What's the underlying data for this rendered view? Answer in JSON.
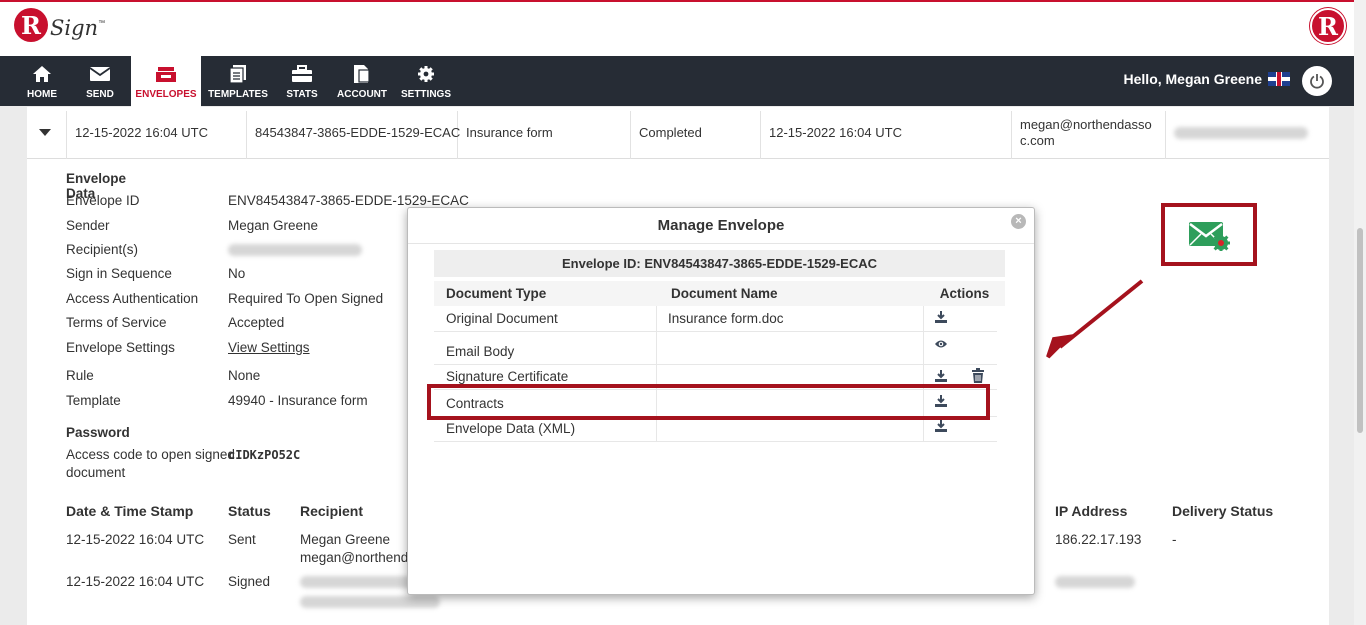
{
  "app": {
    "logo_letter": "R",
    "logo_text": "Sign",
    "logo_tm": "™"
  },
  "nav": {
    "items": [
      {
        "label": "HOME",
        "icon": "home-icon"
      },
      {
        "label": "SEND",
        "icon": "mail-icon"
      },
      {
        "label": "ENVELOPES",
        "icon": "inbox-icon",
        "active": true
      },
      {
        "label": "TEMPLATES",
        "icon": "template-icon"
      },
      {
        "label": "STATS",
        "icon": "briefcase-icon"
      },
      {
        "label": "ACCOUNT",
        "icon": "account-icon"
      },
      {
        "label": "SETTINGS",
        "icon": "gear-icon"
      }
    ],
    "greeting": "Hello, Megan Greene"
  },
  "envelope_row": {
    "sent_date": "12-15-2022 16:04 UTC",
    "envelope_id": "84543847-3865-EDDE-1529-ECAC",
    "subject": "Insurance form",
    "status": "Completed",
    "completed_date": "12-15-2022 16:04 UTC",
    "sender_email": "megan@northendassoc.com"
  },
  "envelope_data": {
    "heading": "Envelope Data",
    "fields": [
      {
        "label": "Envelope ID",
        "value": "ENV84543847-3865-EDDE-1529-ECAC"
      },
      {
        "label": "Sender",
        "value": "Megan Greene"
      },
      {
        "label": "Recipient(s)",
        "value": ""
      },
      {
        "label": "Sign in Sequence",
        "value": "No"
      },
      {
        "label": "Access Authentication",
        "value": "Required To Open Signed"
      },
      {
        "label": "Terms of Service",
        "value": "Accepted"
      },
      {
        "label": "Envelope Settings",
        "value": "View Settings"
      },
      {
        "label": "Rule",
        "value": "None"
      },
      {
        "label": "Template",
        "value": "49940 - Insurance form"
      }
    ],
    "password_heading": "Password",
    "access_code_label_1": "Access code to open signed",
    "access_code_label_2": "document",
    "access_code": "cIDKzPO52C"
  },
  "history": {
    "columns": [
      "Date & Time Stamp",
      "Status",
      "Recipient",
      "IP Address",
      "Delivery Status"
    ],
    "rows": [
      {
        "date": "12-15-2022 16:04 UTC",
        "status": "Sent",
        "recipient": "Megan Greene",
        "recipient_email": "megan@northenda",
        "ip": "186.22.17.193",
        "delivery": "-"
      },
      {
        "date": "12-15-2022 16:04 UTC",
        "status": "Signed",
        "recipient": "",
        "recipient_email": "",
        "ip": "",
        "delivery": ""
      }
    ]
  },
  "modal": {
    "title": "Manage Envelope",
    "envelope_id_line": "Envelope ID: ENV84543847-3865-EDDE-1529-ECAC",
    "columns": [
      "Document Type",
      "Document Name",
      "Actions"
    ],
    "rows": [
      {
        "type": "Original Document",
        "name": "Insurance form.doc",
        "actions": [
          "download-icon"
        ]
      },
      {
        "type": "Email Body",
        "name": "",
        "actions": [
          "eye-icon"
        ]
      },
      {
        "type": "Signature Certificate",
        "name": "",
        "actions": [
          "download-icon",
          "trash-icon"
        ]
      },
      {
        "type": "Contracts",
        "name": "",
        "actions": [
          "download-icon"
        ]
      },
      {
        "type": "Envelope Data (XML)",
        "name": "",
        "actions": [
          "download-icon"
        ]
      }
    ]
  },
  "colors": {
    "brand_red": "#c8102e",
    "nav_bg": "#262c35",
    "highlight": "#a5121d",
    "mail_green": "#2e9e5b"
  }
}
